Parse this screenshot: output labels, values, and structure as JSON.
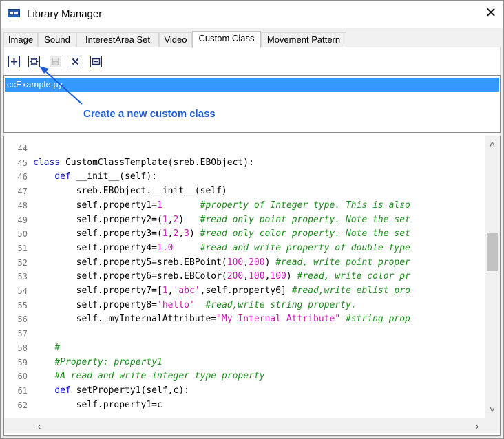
{
  "window": {
    "title": "Library Manager"
  },
  "tabs": [
    {
      "label": "Image",
      "active": false
    },
    {
      "label": "Sound",
      "active": false
    },
    {
      "label": "InterestArea Set",
      "active": false
    },
    {
      "label": "Video",
      "active": false
    },
    {
      "label": "Custom Class",
      "active": true
    },
    {
      "label": "Movement Pattern",
      "active": false
    }
  ],
  "toolbar": {
    "buttons": [
      {
        "name": "add-icon",
        "enabled": true
      },
      {
        "name": "new-custom-class-icon",
        "enabled": true
      },
      {
        "name": "save-icon",
        "enabled": false
      },
      {
        "name": "delete-icon",
        "enabled": true
      },
      {
        "name": "properties-icon",
        "enabled": true
      }
    ]
  },
  "file_list": {
    "items": [
      "ccExample.py"
    ],
    "selected_index": 0
  },
  "annotation": {
    "text": "Create a new custom class"
  },
  "editor": {
    "lines": [
      {
        "n": "44",
        "tokens": []
      },
      {
        "n": "45",
        "tokens": [
          [
            "kw",
            "class "
          ],
          [
            "plain",
            "CustomClassTemplate(sreb.EBObject):"
          ]
        ]
      },
      {
        "n": "46",
        "tokens": [
          [
            "plain",
            "    "
          ],
          [
            "kw",
            "def "
          ],
          [
            "plain",
            "__init__(self):"
          ]
        ]
      },
      {
        "n": "47",
        "tokens": [
          [
            "plain",
            "        sreb.EBObject.__init__(self)"
          ]
        ]
      },
      {
        "n": "48",
        "tokens": [
          [
            "plain",
            "        self.property1="
          ],
          [
            "num",
            "1"
          ],
          [
            "plain",
            "       "
          ],
          [
            "cmt",
            "#property of Integer type. This is also"
          ]
        ]
      },
      {
        "n": "49",
        "tokens": [
          [
            "plain",
            "        self.property2=("
          ],
          [
            "num",
            "1"
          ],
          [
            "plain",
            ","
          ],
          [
            "num",
            "2"
          ],
          [
            "plain",
            ")   "
          ],
          [
            "cmt",
            "#read only point property. Note the set"
          ]
        ]
      },
      {
        "n": "50",
        "tokens": [
          [
            "plain",
            "        self.property3=("
          ],
          [
            "num",
            "1"
          ],
          [
            "plain",
            ","
          ],
          [
            "num",
            "2"
          ],
          [
            "plain",
            ","
          ],
          [
            "num",
            "3"
          ],
          [
            "plain",
            ") "
          ],
          [
            "cmt",
            "#read only color property. Note the set"
          ]
        ]
      },
      {
        "n": "51",
        "tokens": [
          [
            "plain",
            "        self.property4="
          ],
          [
            "num",
            "1.0"
          ],
          [
            "plain",
            "     "
          ],
          [
            "cmt",
            "#read and write property of double type"
          ]
        ]
      },
      {
        "n": "52",
        "tokens": [
          [
            "plain",
            "        self.property5=sreb.EBPoint("
          ],
          [
            "num",
            "100"
          ],
          [
            "plain",
            ","
          ],
          [
            "num",
            "200"
          ],
          [
            "plain",
            ") "
          ],
          [
            "cmt",
            "#read, write point proper"
          ]
        ]
      },
      {
        "n": "53",
        "tokens": [
          [
            "plain",
            "        self.property6=sreb.EBColor("
          ],
          [
            "num",
            "200"
          ],
          [
            "plain",
            ","
          ],
          [
            "num",
            "100"
          ],
          [
            "plain",
            ","
          ],
          [
            "num",
            "100"
          ],
          [
            "plain",
            ") "
          ],
          [
            "cmt",
            "#read, write color pr"
          ]
        ]
      },
      {
        "n": "54",
        "tokens": [
          [
            "plain",
            "        self.property7=["
          ],
          [
            "num",
            "1"
          ],
          [
            "plain",
            ","
          ],
          [
            "str",
            "'abc'"
          ],
          [
            "plain",
            ",self.property6] "
          ],
          [
            "cmt",
            "#read,write eblist pro"
          ]
        ]
      },
      {
        "n": "55",
        "tokens": [
          [
            "plain",
            "        self.property8="
          ],
          [
            "str",
            "'hello'"
          ],
          [
            "plain",
            "  "
          ],
          [
            "cmt",
            "#read,write string property."
          ]
        ]
      },
      {
        "n": "56",
        "tokens": [
          [
            "plain",
            "        self._myInternalAttribute="
          ],
          [
            "str",
            "\"My Internal Attribute\""
          ],
          [
            "plain",
            " "
          ],
          [
            "cmt",
            "#string prop"
          ]
        ]
      },
      {
        "n": "57",
        "tokens": []
      },
      {
        "n": "58",
        "tokens": [
          [
            "plain",
            "    "
          ],
          [
            "cmt",
            "#"
          ]
        ]
      },
      {
        "n": "59",
        "tokens": [
          [
            "plain",
            "    "
          ],
          [
            "cmt",
            "#Property: property1"
          ]
        ]
      },
      {
        "n": "60",
        "tokens": [
          [
            "plain",
            "    "
          ],
          [
            "cmt",
            "#A read and write integer type property"
          ]
        ]
      },
      {
        "n": "61",
        "tokens": [
          [
            "plain",
            "    "
          ],
          [
            "kw",
            "def "
          ],
          [
            "plain",
            "setProperty1(self,c):"
          ]
        ]
      },
      {
        "n": "62",
        "tokens": [
          [
            "plain",
            "        self.property1=c"
          ]
        ]
      }
    ]
  }
}
